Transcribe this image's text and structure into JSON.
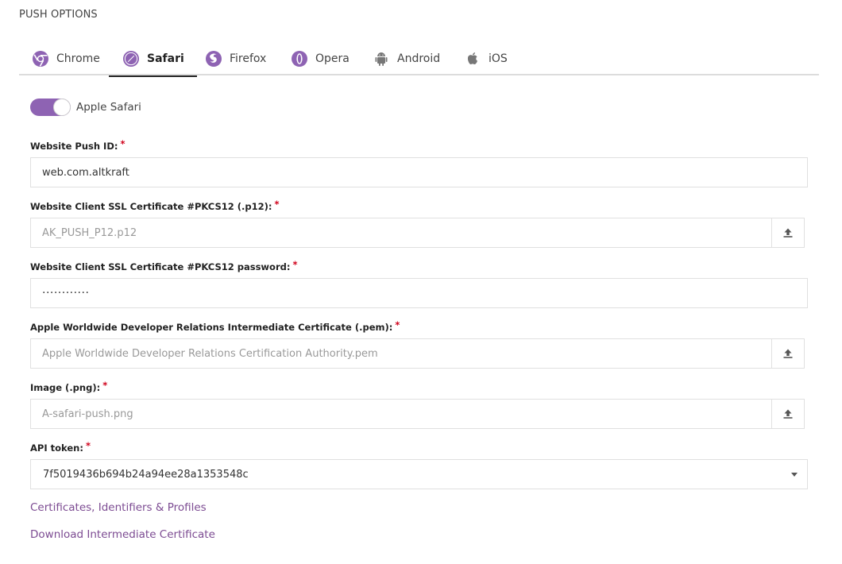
{
  "section_title": "PUSH OPTIONS",
  "tabs": [
    {
      "label": "Chrome",
      "icon": "chrome-icon"
    },
    {
      "label": "Safari",
      "icon": "safari-icon",
      "active": true
    },
    {
      "label": "Firefox",
      "icon": "firefox-icon"
    },
    {
      "label": "Opera",
      "icon": "opera-icon"
    },
    {
      "label": "Android",
      "icon": "android-icon"
    },
    {
      "label": "iOS",
      "icon": "apple-icon"
    }
  ],
  "toggle": {
    "label": "Apple Safari",
    "on": true
  },
  "fields": {
    "push_id": {
      "label": "Website Push ID:",
      "value": "web.com.altkraft"
    },
    "ssl_cert": {
      "label": "Website Client SSL Certificate #PKCS12 (.p12):",
      "placeholder": "AK_PUSH_P12.p12"
    },
    "ssl_password": {
      "label": "Website Client SSL Certificate #PKCS12 password:",
      "value": "············"
    },
    "intermediate_cert": {
      "label": "Apple Worldwide Developer Relations Intermediate Certificate (.pem):",
      "placeholder": "Apple Worldwide Developer Relations Certification Authority.pem"
    },
    "image": {
      "label": "Image (.png):",
      "placeholder": "A-safari-push.png"
    },
    "api_token": {
      "label": "API token:",
      "value": "7f5019436b694b24a94ee28a1353548c"
    }
  },
  "required_marker": "*",
  "links": {
    "certificates": "Certificates, Identifiers & Profiles",
    "download": "Download Intermediate Certificate"
  },
  "colors": {
    "accent": "#8e63b3",
    "link": "#7c4b92",
    "required": "#d0021b",
    "icon": "#8e63b3"
  }
}
